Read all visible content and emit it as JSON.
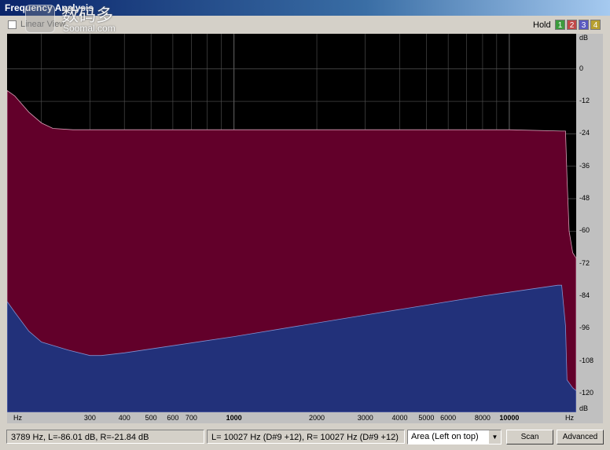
{
  "window": {
    "title": "Frequency Analysis"
  },
  "toolbar": {
    "linear_view_label": "Linear View",
    "linear_view_checked": false,
    "hold_label": "Hold",
    "hold_buttons": [
      {
        "label": "1",
        "color": "#3c9b3c"
      },
      {
        "label": "2",
        "color": "#c04848"
      },
      {
        "label": "3",
        "color": "#5a5ac0"
      },
      {
        "label": "4",
        "color": "#b8a030"
      }
    ]
  },
  "watermark": {
    "chinese": "数码多",
    "english": "Soomal.com"
  },
  "colors": {
    "left_channel": "#22317a",
    "right_channel": "#62002a",
    "grid": "#555555"
  },
  "chart_data": {
    "type": "area",
    "title": "",
    "xlabel": "Hz",
    "ylabel": "dB",
    "x_scale": "log",
    "x_tick_labels": [
      "300",
      "400",
      "500",
      "600",
      "700",
      "1000",
      "2000",
      "3000",
      "4000",
      "5000",
      "6000",
      "8000",
      "10000"
    ],
    "x_ticks": [
      300,
      400,
      500,
      600,
      700,
      1000,
      2000,
      3000,
      4000,
      5000,
      6000,
      8000,
      10000
    ],
    "y_ticks": [
      0,
      -12,
      -24,
      -36,
      -48,
      -60,
      -72,
      -84,
      -96,
      -108,
      -120
    ],
    "ylim": [
      -127,
      13
    ],
    "xlim": [
      150,
      17500
    ],
    "y_unit_label": "dB",
    "x_unit_label": "Hz",
    "series": [
      {
        "name": "R",
        "x": [
          150,
          160,
          180,
          200,
          220,
          260,
          400,
          1000,
          3000,
          10000,
          15500,
          16000,
          16200,
          16500,
          17000,
          17500
        ],
        "values": [
          -8,
          -10,
          -16,
          -20,
          -22,
          -22.5,
          -22.5,
          -22.5,
          -22.5,
          -22.5,
          -23,
          -23,
          -40,
          -60,
          -68,
          -70
        ]
      },
      {
        "name": "L",
        "x": [
          150,
          160,
          180,
          200,
          250,
          300,
          330,
          400,
          1000,
          3000,
          8000,
          15000,
          15500,
          16000,
          16200,
          17000,
          17500
        ],
        "values": [
          -86,
          -90,
          -97,
          -101,
          -104,
          -106,
          -106,
          -105,
          -99,
          -91,
          -84,
          -80,
          -80,
          -95,
          -115,
          -118,
          -119
        ]
      }
    ]
  },
  "status": {
    "cursor_readout": "3789 Hz, L=-86.01 dB, R=-21.84 dB",
    "peak_readout": "L=  10027 Hz (D#9 +12), R=  10027 Hz (D#9 +12)",
    "display_mode": "Area (Left on top)",
    "scan_label": "Scan",
    "advanced_label": "Advanced"
  }
}
